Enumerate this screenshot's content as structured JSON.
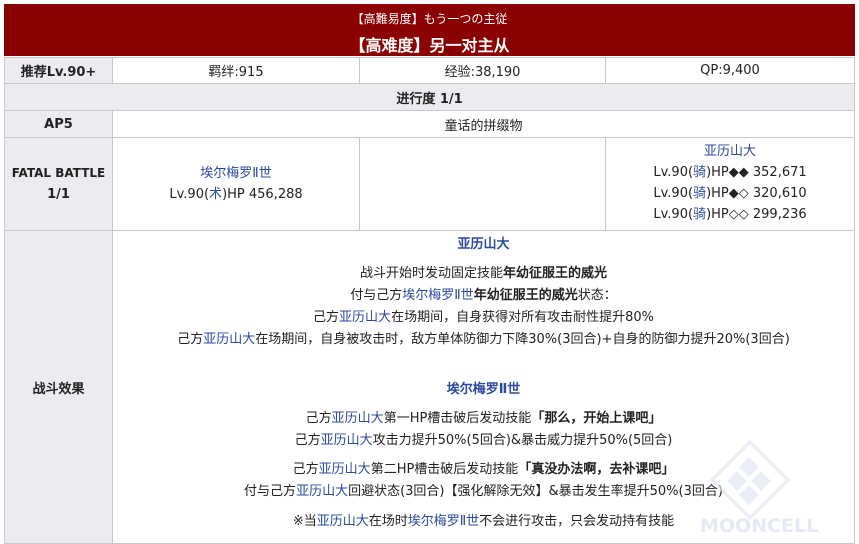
{
  "title": {
    "jp": "【高難易度】もう一つの主従",
    "cn": "【高难度】另一对主从"
  },
  "row1": {
    "recommend": "推荐Lv.90+",
    "bond": "羁绊:915",
    "exp": "经验:38,190",
    "qp": "QP:9,400"
  },
  "progress": "进行度 1/1",
  "ap_row": {
    "ap": "AP5",
    "drop": "童话的拼缀物"
  },
  "fatal_battle": {
    "label": "FATAL BATTLE",
    "count": "1/1",
    "enemy1": {
      "name": "埃尔梅罗Ⅱ世",
      "pre": "Lv.90(",
      "cls": "术",
      "post": ")HP 456,288"
    },
    "enemy3": {
      "name": "亚历山大",
      "lines": [
        {
          "pre": "Lv.90(",
          "cls": "骑",
          "post": ")HP◆◆ 352,671"
        },
        {
          "pre": "Lv.90(",
          "cls": "骑",
          "post": ")HP◆◇ 320,610"
        },
        {
          "pre": "Lv.90(",
          "cls": "骑",
          "post": ")HP◇◇ 299,236"
        }
      ]
    }
  },
  "effects": {
    "label": "战斗效果",
    "s1": {
      "title": "亚历山大",
      "l1a": "战斗开始时发动固定技能",
      "l1b": "年幼征服王的威光",
      "l2a": "付与己方",
      "l2b": "埃尔梅罗Ⅱ世",
      "l2c": "年幼征服王的威光",
      "l2d": "状态：",
      "l3a": "己方",
      "l3b": "亚历山大",
      "l3c": "在场期间，自身获得对所有攻击耐性提升80%",
      "l4a": "己方",
      "l4b": "亚历山大",
      "l4c": "在场期间，自身被攻击时，敌方单体防御力下降30%(3回合)+自身的防御力提升20%(3回合)"
    },
    "s2": {
      "title": "埃尔梅罗Ⅱ世",
      "l1a": "己方",
      "l1b": "亚历山大",
      "l1c": "第一HP槽击破后发动技能",
      "l1d": "「那么，开始上课吧」",
      "l2a": "己方",
      "l2b": "亚历山大",
      "l2c": "攻击力提升50%(5回合)&暴击威力提升50%(5回合)",
      "l3a": "己方",
      "l3b": "亚历山大",
      "l3c": "第二HP槽击破后发动技能",
      "l3d": "「真没办法啊，去补课吧」",
      "l4a": "付与己方",
      "l4b": "亚历山大",
      "l4c": "回避状态(3回合)【强化解除无效】&暴击发生率提升50%(3回合)",
      "l5a": "※当",
      "l5b": "亚历山大",
      "l5c": "在场时",
      "l5d": "埃尔梅罗Ⅱ世",
      "l5e": "不会进行攻击，只会发动持有技能"
    }
  },
  "watermark": "MOONCELL",
  "colors": {
    "title_bg": "#8b0000",
    "header_bg": "#eaecf0",
    "link": "#2b4ba0",
    "border": "#c8c8c8"
  }
}
